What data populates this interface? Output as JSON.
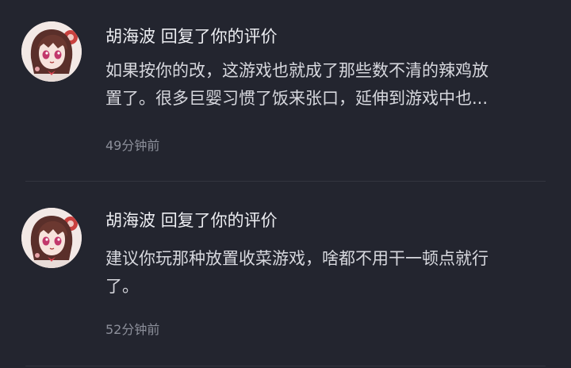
{
  "comments": [
    {
      "username": "胡海波",
      "action": "回复了你的评价",
      "content_lines": [
        "如果按你的改，这游戏也就成了那些数不清的辣鸡放",
        "置了。很多巨婴习惯了饭来张口，延伸到游戏中也..."
      ],
      "time": "49分钟前",
      "avatar_icon": "anime-girl-avatar"
    },
    {
      "username": "胡海波",
      "action": "回复了你的评价",
      "content_lines": [
        "建议你玩那种放置收菜游戏，啥都不用干一顿点就行",
        "了。"
      ],
      "time": "52分钟前",
      "avatar_icon": "anime-girl-avatar"
    }
  ],
  "colors": {
    "background": "#23252f",
    "title": "#ecedf1",
    "body": "#d7d8de",
    "time": "#8c8f9a",
    "divider": "#33353f"
  }
}
